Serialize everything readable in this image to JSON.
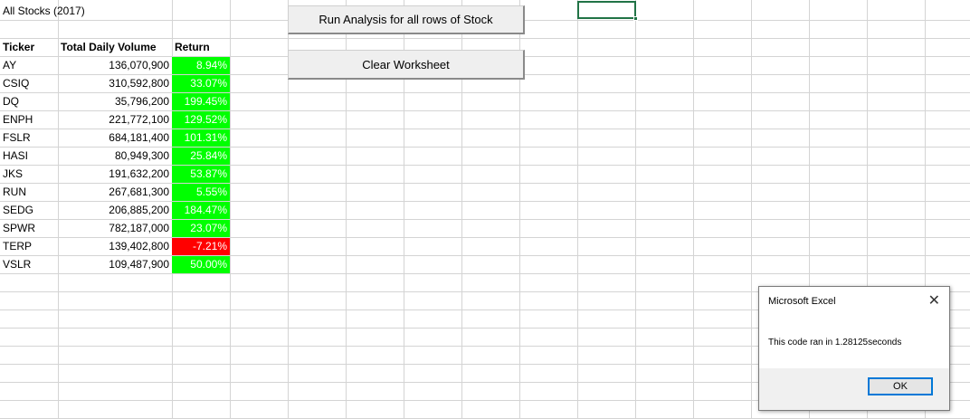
{
  "sheet": {
    "title": "All Stocks (2017)",
    "headers": [
      "Ticker",
      "Total Daily Volume",
      "Return"
    ],
    "rows": [
      {
        "ticker": "AY",
        "volume": "136,070,900",
        "return": "8.94%",
        "positive": true
      },
      {
        "ticker": "CSIQ",
        "volume": "310,592,800",
        "return": "33.07%",
        "positive": true
      },
      {
        "ticker": "DQ",
        "volume": "35,796,200",
        "return": "199.45%",
        "positive": true
      },
      {
        "ticker": "ENPH",
        "volume": "221,772,100",
        "return": "129.52%",
        "positive": true
      },
      {
        "ticker": "FSLR",
        "volume": "684,181,400",
        "return": "101.31%",
        "positive": true
      },
      {
        "ticker": "HASI",
        "volume": "80,949,300",
        "return": "25.84%",
        "positive": true
      },
      {
        "ticker": "JKS",
        "volume": "191,632,200",
        "return": "53.87%",
        "positive": true
      },
      {
        "ticker": "RUN",
        "volume": "267,681,300",
        "return": "5.55%",
        "positive": true
      },
      {
        "ticker": "SEDG",
        "volume": "206,885,200",
        "return": "184.47%",
        "positive": true
      },
      {
        "ticker": "SPWR",
        "volume": "782,187,000",
        "return": "23.07%",
        "positive": true
      },
      {
        "ticker": "TERP",
        "volume": "139,402,800",
        "return": "-7.21%",
        "positive": false
      },
      {
        "ticker": "VSLR",
        "volume": "109,487,900",
        "return": "50.00%",
        "positive": true
      }
    ]
  },
  "buttons": {
    "run_analysis": "Run Analysis for all rows of Stock",
    "clear_worksheet": "Clear Worksheet"
  },
  "dialog": {
    "title": "Microsoft Excel",
    "close_glyph": "✕",
    "message": "This code ran in 1.28125seconds",
    "ok_label": "OK"
  },
  "colors": {
    "positive": "#00ff00",
    "negative": "#ff0000",
    "gridline": "#d4d4d4",
    "selection": "#217346"
  }
}
